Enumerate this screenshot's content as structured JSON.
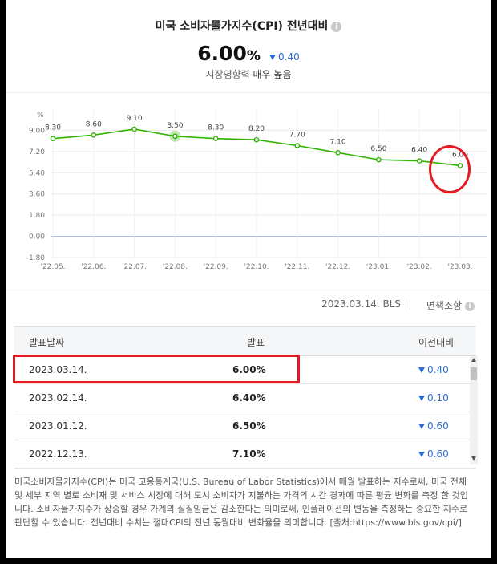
{
  "header": {
    "title": "미국 소비자물가지수(CPI) 전년대비",
    "info_icon": "i",
    "value": "6.00",
    "value_unit": "%",
    "change": "0.40",
    "change_direction": "down",
    "impact_label": "시장영향력",
    "impact_value": "매우 높음"
  },
  "chart_data": {
    "type": "line",
    "y_unit": "%",
    "categories": [
      "'22.05.",
      "'22.06.",
      "'22.07.",
      "'22.08.",
      "'22.09.",
      "'22.10.",
      "'22.11.",
      "'22.12.",
      "'23.01.",
      "'23.02.",
      "'23.03."
    ],
    "values": [
      8.3,
      8.6,
      9.1,
      8.5,
      8.3,
      8.2,
      7.7,
      7.1,
      6.5,
      6.4,
      6.0
    ],
    "data_labels": [
      "8.30",
      "8.60",
      "9.10",
      "8.50",
      "8.30",
      "8.20",
      "7.70",
      "7.10",
      "6.50",
      "6.40",
      "6.00"
    ],
    "y_ticks": [
      "9.00",
      "7.20",
      "5.40",
      "3.60",
      "1.80",
      "0.00",
      "-1.80"
    ],
    "ylim": [
      -1.8,
      10.8
    ],
    "highlight_index": 3,
    "line_color": "#2db400",
    "grid": true
  },
  "source": {
    "date_source": "2023.03.14. BLS",
    "disclaimer": "면책조항"
  },
  "table": {
    "headers": {
      "date": "발표날짜",
      "value": "발표",
      "diff": "이전대비"
    },
    "rows": [
      {
        "date": "2023.03.14.",
        "value": "6.00%",
        "diff": "0.40"
      },
      {
        "date": "2023.02.14.",
        "value": "6.40%",
        "diff": "0.10"
      },
      {
        "date": "2023.01.12.",
        "value": "6.50%",
        "diff": "0.60"
      },
      {
        "date": "2022.12.13.",
        "value": "7.10%",
        "diff": "0.60"
      }
    ]
  },
  "description": "미국소비자물가지수(CPI)는 미국 고용통계국(U.S. Bureau of Labor Statistics)에서 매월 발표하는 지수로써, 미국 전체 및 세부 지역 별로 소비재 및 서비스 시장에 대해 도시 소비자가 지불하는 가격의 시간 경과에 따른 평균 변화를 측정 한 것입니다. 소비자물가지수가 상승할 경우 가계의 실질임금은 감소한다는 의미로써, 인플레이션의 변동을 측정하는 중요한 지수로 판단할 수 있습니다. 전년대비 수치는 절대CPI의 전년 동월대비 변화율을 의미합니다. [출처:https://www.bls.gov/cpi/]",
  "colors": {
    "accent_blue": "#2b6cd6",
    "highlight_red": "#e31b23",
    "line_green": "#2db400"
  }
}
